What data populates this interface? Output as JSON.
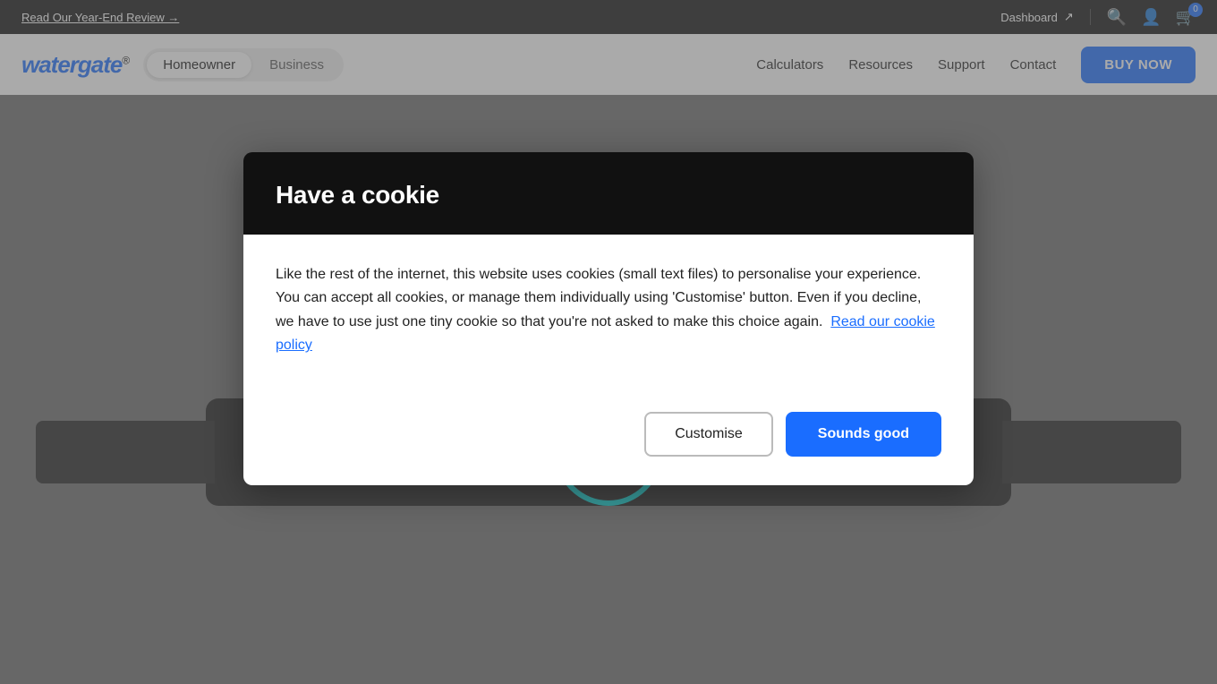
{
  "topbar": {
    "review_link": "Read Our Year-End Review →",
    "dashboard_label": "Dashboard",
    "external_icon": "↗",
    "cart_count": "0"
  },
  "nav": {
    "logo_text": "watergate",
    "logo_reg": "®",
    "pill_homeowner": "Homeowner",
    "pill_business": "Business",
    "link_calculators": "Calculators",
    "link_resources": "Resources",
    "link_support": "Support",
    "link_contact": "Contact",
    "buy_now": "BUY NOW"
  },
  "cookie_modal": {
    "title": "Have a cookie",
    "body": "Like the rest of the internet, this website uses cookies (small text files) to personalise your experience. You can accept all cookies, or manage them individually using 'Customise' button. Even if you decline, we have to use just one tiny cookie so that you're not asked to make this choice again.",
    "policy_link": "Read our cookie policy",
    "btn_customise": "Customise",
    "btn_accept": "Sounds good"
  }
}
